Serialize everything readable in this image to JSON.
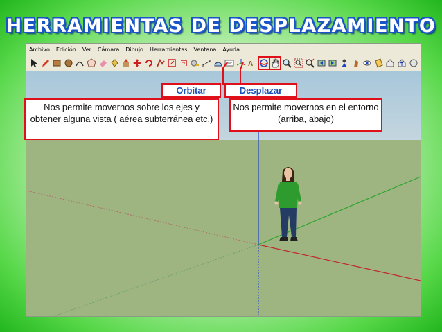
{
  "title": "HERRAMIENTAS DE DESPLAZAMIENTO",
  "menu": [
    "Archivo",
    "Edición",
    "Ver",
    "Cámara",
    "Dibujo",
    "Herramientas",
    "Ventana",
    "Ayuda"
  ],
  "toolbar_icons": [
    "arrow-icon",
    "pencil-icon",
    "rectangle-icon",
    "circle-icon",
    "arc-icon",
    "polygon-icon",
    "eraser-icon",
    "paint-bucket-icon",
    "push-pull-icon",
    "move-icon",
    "rotate-icon",
    "follow-me-icon",
    "scale-icon",
    "offset-icon",
    "tape-measure-icon",
    "dimension-icon",
    "protractor-icon",
    "text-icon",
    "axes-icon",
    "3d-text-icon",
    "orbit-icon",
    "pan-icon",
    "zoom-icon",
    "zoom-window-icon",
    "zoom-extents-icon",
    "previous-view-icon",
    "next-view-icon",
    "position-camera-icon",
    "walk-icon",
    "look-around-icon",
    "section-plane-icon",
    "get-models-icon",
    "share-model-icon",
    "components-icon",
    "extension-icon"
  ],
  "labels": {
    "orbit_label": "Orbitar",
    "pan_label": "Desplazar",
    "orbit_description": "Nos permite movernos sobre los ejes y obtener alguna vista ( aérea subterránea etc.)",
    "pan_description": "Nos permite movernos en el entorno (arriba, abajo)"
  },
  "colors": {
    "title_outline": "#1a55c8",
    "callout_border": "#e0101a",
    "callout_label_text": "#1a4fb5",
    "ground": "#9eb582",
    "sky": "#b5cfdc"
  }
}
